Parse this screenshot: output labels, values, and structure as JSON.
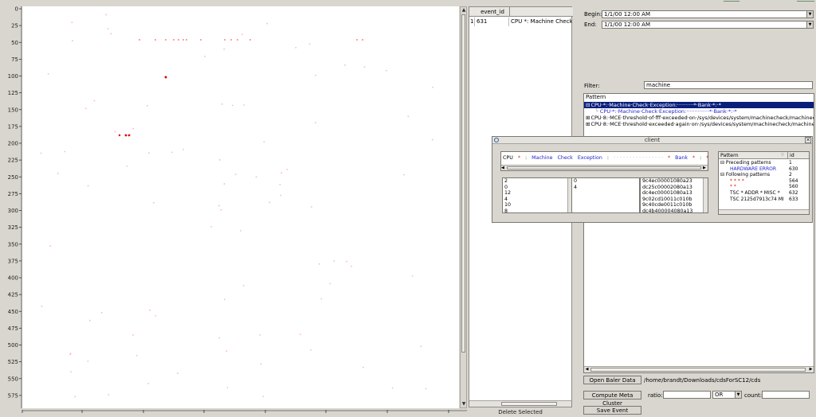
{
  "colors": {
    "point": "#ff3333",
    "selected_row": "#0a1f7a",
    "blue_text": "#2222cc",
    "red_text": "#dd2222"
  },
  "scatter": {
    "y_ticks": [
      "0",
      "25",
      "50",
      "75",
      "100",
      "125",
      "150",
      "175",
      "200",
      "225",
      "250",
      "275",
      "300",
      "325",
      "350",
      "375",
      "400",
      "425",
      "450",
      "475",
      "500",
      "525",
      "550",
      "575"
    ]
  },
  "event_table": {
    "column": "event_id",
    "rows": [
      {
        "index": "1",
        "event_id": "631",
        "text": "CPU *: Machine Check Exc"
      }
    ],
    "delete_label": "Delete Selected"
  },
  "time_range": {
    "begin_label": "Begin:",
    "begin_value": "1/1/00 12:00 AM",
    "end_label": "End:",
    "end_value": "1/1/00 12:00 AM"
  },
  "filter": {
    "label": "Filter:",
    "value": "machine"
  },
  "pattern_tree": {
    "header": "Pattern",
    "rows": [
      {
        "toggle": "⊟",
        "text": "CPU·*:·Machine·Check·Exception:··········*·Bank·*:·*",
        "selected": true,
        "indent": 0
      },
      {
        "toggle": "",
        "text": "CPU·*:·Machine·Check·Exception:··············*·Bank·*:·*",
        "selected": false,
        "indent": 1,
        "blue": true
      },
      {
        "toggle": "⊞",
        "text": "CPU·8:·MCE·threshold·of·fff·exceeded·on·/sys/devices/system/machinecheck/machineche",
        "selected": false,
        "indent": 0
      },
      {
        "toggle": "⊞",
        "text": "CPU·8:·MCE·threshold·exceeded·again·on·/sys/devices/system/machinecheck/machineche",
        "selected": false,
        "indent": 0
      }
    ]
  },
  "client": {
    "title": "client",
    "pattern_tokens": [
      {
        "text": "CPU",
        "style": "black"
      },
      {
        "text": "*",
        "style": "red"
      },
      {
        "text": ":",
        "style": "black"
      },
      {
        "text": "Machine",
        "style": "blue"
      },
      {
        "text": "Check",
        "style": "blue"
      },
      {
        "text": "Exception",
        "style": "blue"
      },
      {
        "text": ":",
        "style": "black"
      },
      {
        "text": "· · · · · · · · · · · · · · · ·",
        "style": "dots"
      },
      {
        "text": "*",
        "style": "red"
      },
      {
        "text": "Bank",
        "style": "blue"
      },
      {
        "text": "*",
        "style": "red"
      },
      {
        "text": ":",
        "style": "black"
      },
      {
        "text": "*",
        "style": "red"
      }
    ],
    "list1": [
      "2",
      "0",
      "12",
      "4",
      "10",
      "8"
    ],
    "list2": [
      "0",
      "4"
    ],
    "list3": [
      "9c4ec00001080a23",
      "dc25c00002080a13",
      "dc4ec00001080a13",
      "9c02cd10011c010b",
      "9c40cde0011c010b",
      "dc4b400004080a13"
    ],
    "context_tree": {
      "col1": "Pattern",
      "col2": "id",
      "rows": [
        {
          "label": "⊟ Preceding patterns",
          "id": "1",
          "style": "black",
          "indent": 0
        },
        {
          "label": "HARDWARE ERROR",
          "id": "630",
          "style": "blue",
          "indent": 2
        },
        {
          "label": "⊟ Following patterns",
          "id": "2",
          "style": "black",
          "indent": 0
        },
        {
          "label": "* * * *",
          "id": "564",
          "style": "red",
          "indent": 2
        },
        {
          "label": "* *",
          "id": "560",
          "style": "red",
          "indent": 2
        },
        {
          "label": "TSC * ADDR * MISC *",
          "id": "632",
          "style": "mixed",
          "indent": 2
        },
        {
          "label": "TSC 2125d7913c74 MI",
          "id": "633",
          "style": "mixed2",
          "indent": 2
        }
      ]
    }
  },
  "controls": {
    "open_label": "Open Baler Data",
    "path": "/home/brandt/Downloads/cdsForSC12/cds",
    "compute_label": "Compute Meta Cluster",
    "ratio_label": "ratio:",
    "ratio_value": "",
    "op_value": "OR",
    "count_label": "count:",
    "count_value": "",
    "save_label": "Save Event"
  }
}
